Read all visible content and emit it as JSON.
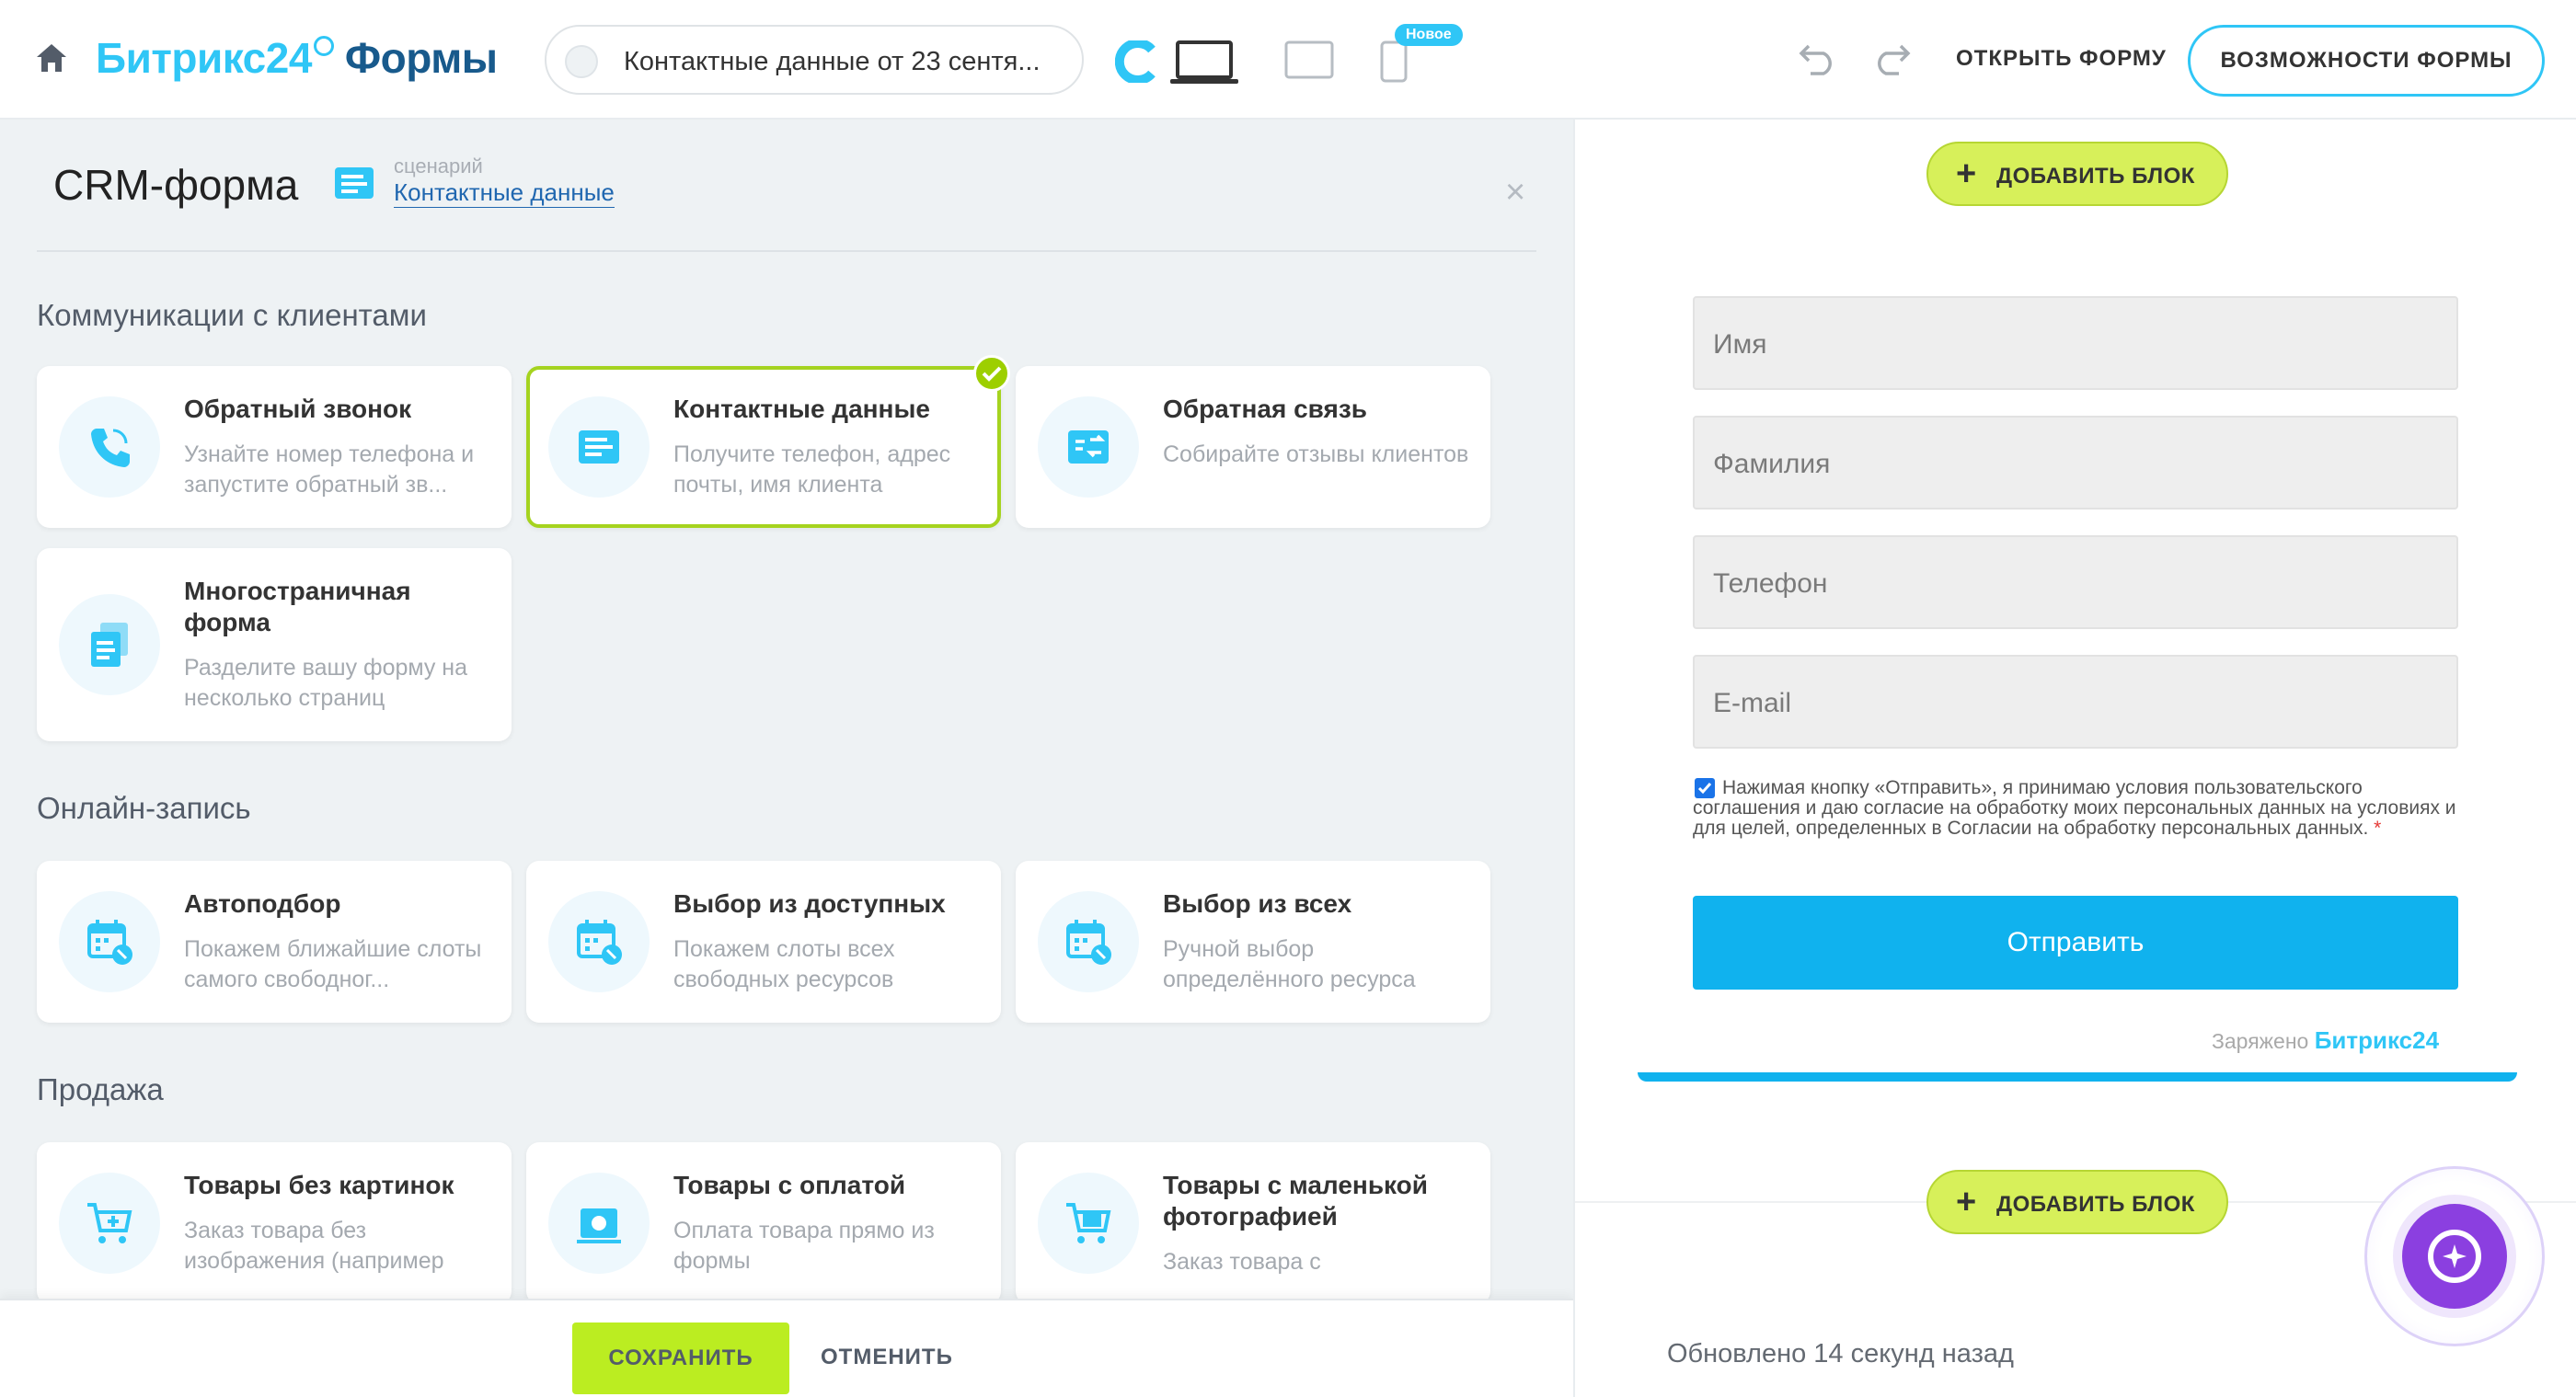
{
  "header": {
    "brand_main": "Битрикс24",
    "brand_product": "Формы",
    "form_title": "Контактные данные от 23 сентя...",
    "new_badge": "Новое",
    "open_form": "ОТКРЫТЬ ФОРМУ",
    "features": "ВОЗМОЖНОСТИ ФОРМЫ"
  },
  "panel": {
    "title": "CRM-форма",
    "scenario_label": "сценарий",
    "scenario_value": "Контактные данные",
    "close": "×"
  },
  "sections": [
    {
      "title": "Коммуникации с клиентами",
      "cards": [
        {
          "title": "Обратный звонок",
          "desc": "Узнайте номер телефона и запустите обратный зв...",
          "icon": "phone-icon",
          "selected": false
        },
        {
          "title": "Контактные данные",
          "desc": "Получите телефон, адрес почты, имя клиента",
          "icon": "contact-card-icon",
          "selected": true
        },
        {
          "title": "Обратная связь",
          "desc": "Собирайте отзывы клиентов",
          "icon": "feedback-icon",
          "selected": false
        },
        {
          "title": "Многостраничная форма",
          "desc": "Разделите вашу форму на несколько страниц",
          "icon": "pages-icon",
          "selected": false
        }
      ]
    },
    {
      "title": "Онлайн-запись",
      "cards": [
        {
          "title": "Автоподбор",
          "desc": "Покажем ближайшие слоты самого свободног...",
          "icon": "calendar-icon"
        },
        {
          "title": "Выбор из доступных",
          "desc": "Покажем слоты всех свободных ресурсов",
          "icon": "calendar-icon"
        },
        {
          "title": "Выбор из всех",
          "desc": "Ручной выбор определённого ресурса",
          "icon": "calendar-icon"
        }
      ]
    },
    {
      "title": "Продажа",
      "cards": [
        {
          "title": "Товары без картинок",
          "desc": "Заказ товара без изображения (например",
          "icon": "cart-icon"
        },
        {
          "title": "Товары с оплатой",
          "desc": "Оплата товара прямо из формы",
          "icon": "payment-icon"
        },
        {
          "title": "Товары с маленькой фотографией",
          "desc": "Заказ товара с",
          "icon": "cart-photo-icon"
        }
      ]
    }
  ],
  "footer": {
    "save": "СОХРАНИТЬ",
    "cancel": "ОТМЕНИТЬ"
  },
  "preview": {
    "add_block": "ДОБАВИТЬ БЛОК",
    "fields": [
      "Имя",
      "Фамилия",
      "Телефон",
      "E-mail"
    ],
    "agreement": "Нажимая кнопку «Отправить», я принимаю условия пользовательского соглашения и даю согласие на обработку моих персональных данных на условиях и для целей, определенных в Согласии на обработку персональных данных.",
    "agreement_star": "*",
    "submit": "Отправить",
    "powered_prefix": "Заряжено",
    "powered_brand": "Битрикс24",
    "updated": "Обновлено 14 секунд назад"
  },
  "colors": {
    "accent": "#2fc6f6",
    "brand_dark": "#185a8c",
    "save_green": "#bbed21",
    "selected_border": "#a5d31f",
    "submit_blue": "#10b2ee"
  }
}
